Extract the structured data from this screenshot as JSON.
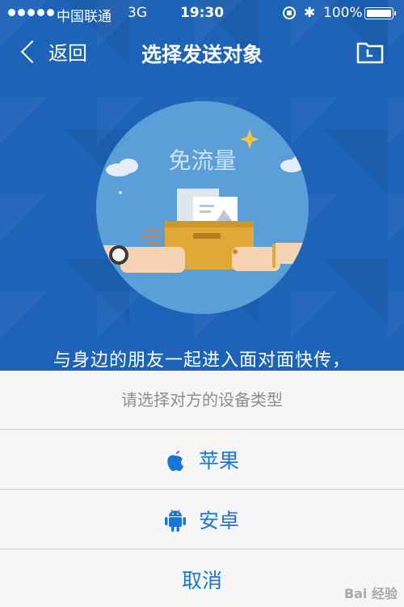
{
  "status_bar": {
    "carrier": "中国联通",
    "network": "3G",
    "time": "19:30",
    "battery": "100%"
  },
  "nav": {
    "back_label": "返回",
    "title": "选择发送对象"
  },
  "illustration": {
    "circle_text": "免流量"
  },
  "tagline": "与身边的朋友一起进入面对面快传，",
  "action_sheet": {
    "title": "请选择对方的设备类型",
    "options": [
      {
        "label": "苹果",
        "icon": "apple-icon"
      },
      {
        "label": "安卓",
        "icon": "android-icon"
      }
    ],
    "cancel_label": "取消"
  },
  "watermark": "Bai 经验",
  "colors": {
    "background": "#1d63b8",
    "accent": "#1877d6",
    "sheet_bg": "#f6f6f6"
  }
}
